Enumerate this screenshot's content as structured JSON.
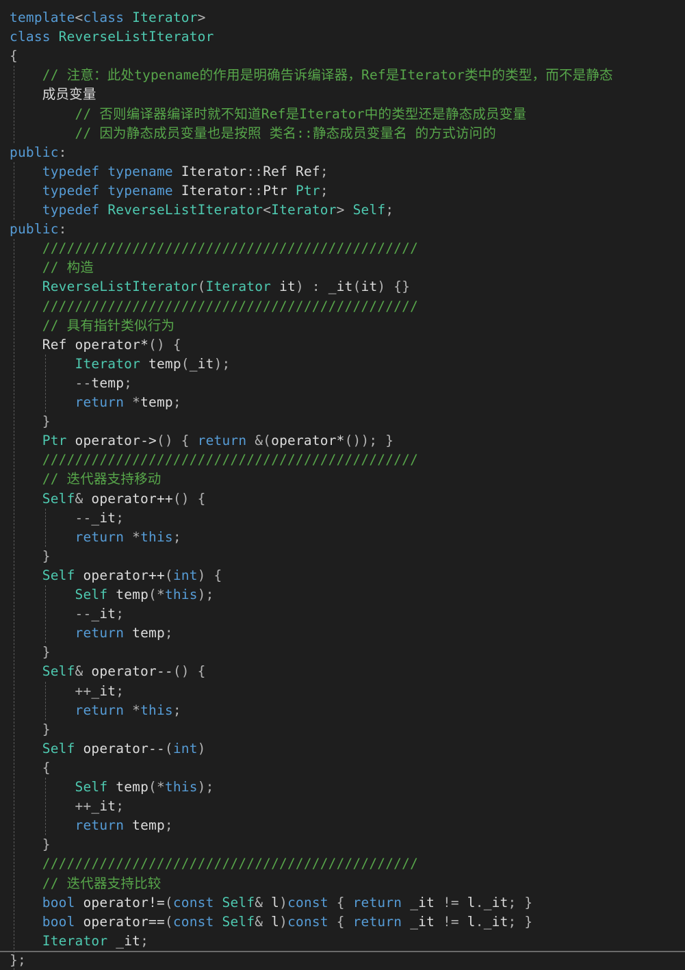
{
  "theme": {
    "background": "#1e1e1e",
    "plain": "#dcdcdc",
    "keyword": "#569cd6",
    "type": "#4ec9b0",
    "comment": "#57a64a",
    "punct": "#b4b4b4",
    "identifier": "#9cdcfe",
    "number": "#b5cea8"
  },
  "code": {
    "lines": [
      [
        [
          "kw",
          "template"
        ],
        [
          "p",
          "<"
        ],
        [
          "kw",
          "class"
        ],
        [
          "p",
          " "
        ],
        [
          "ty",
          "Iterator"
        ],
        [
          "p",
          ">"
        ]
      ],
      [
        [
          "kw",
          "class"
        ],
        [
          "p",
          " "
        ],
        [
          "ty",
          "ReverseListIterator"
        ]
      ],
      [
        [
          "p",
          "{"
        ]
      ],
      [
        [
          "p",
          "    "
        ],
        [
          "cm",
          "// 注意：此处typename的作用是明确告诉编译器，Ref是Iterator类中的类型，而不是静态"
        ]
      ],
      [
        [
          "p",
          "    "
        ],
        [
          "pl",
          "成员变量"
        ]
      ],
      [
        [
          "p",
          "        "
        ],
        [
          "cm",
          "// 否则编译器编译时就不知道Ref是Iterator中的类型还是静态成员变量"
        ]
      ],
      [
        [
          "p",
          "        "
        ],
        [
          "cm",
          "// 因为静态成员变量也是按照 类名::静态成员变量名 的方式访问的"
        ]
      ],
      [
        [
          "kw",
          "public"
        ],
        [
          "p",
          ":"
        ]
      ],
      [
        [
          "p",
          "    "
        ],
        [
          "kw",
          "typedef"
        ],
        [
          "p",
          " "
        ],
        [
          "kw",
          "typename"
        ],
        [
          "p",
          " "
        ],
        [
          "pl",
          "Iterator"
        ],
        [
          "p",
          "::"
        ],
        [
          "pl",
          "Ref"
        ],
        [
          "p",
          " "
        ],
        [
          "pl",
          "Ref"
        ],
        [
          "p",
          ";"
        ]
      ],
      [
        [
          "p",
          "    "
        ],
        [
          "kw",
          "typedef"
        ],
        [
          "p",
          " "
        ],
        [
          "kw",
          "typename"
        ],
        [
          "p",
          " "
        ],
        [
          "pl",
          "Iterator"
        ],
        [
          "p",
          "::"
        ],
        [
          "pl",
          "Ptr"
        ],
        [
          "p",
          " "
        ],
        [
          "ty",
          "Ptr"
        ],
        [
          "p",
          ";"
        ]
      ],
      [
        [
          "p",
          "    "
        ],
        [
          "kw",
          "typedef"
        ],
        [
          "p",
          " "
        ],
        [
          "ty",
          "ReverseListIterator"
        ],
        [
          "p",
          "<"
        ],
        [
          "ty",
          "Iterator"
        ],
        [
          "p",
          "> "
        ],
        [
          "ty",
          "Self"
        ],
        [
          "p",
          ";"
        ]
      ],
      [
        [
          "kw",
          "public"
        ],
        [
          "p",
          ":"
        ]
      ],
      [
        [
          "p",
          "    "
        ],
        [
          "cm",
          "//////////////////////////////////////////////"
        ]
      ],
      [
        [
          "p",
          "    "
        ],
        [
          "cm",
          "// 构造"
        ]
      ],
      [
        [
          "p",
          "    "
        ],
        [
          "fn",
          "ReverseListIterator"
        ],
        [
          "p",
          "("
        ],
        [
          "ty",
          "Iterator"
        ],
        [
          "p",
          " "
        ],
        [
          "pl",
          "it"
        ],
        [
          "p",
          ") : "
        ],
        [
          "pl",
          "_it"
        ],
        [
          "p",
          "("
        ],
        [
          "pl",
          "it"
        ],
        [
          "p",
          ") {}"
        ]
      ],
      [
        [
          "p",
          "    "
        ],
        [
          "cm",
          "//////////////////////////////////////////////"
        ]
      ],
      [
        [
          "p",
          "    "
        ],
        [
          "cm",
          "// 具有指针类似行为"
        ]
      ],
      [
        [
          "p",
          "    "
        ],
        [
          "pl",
          "Ref"
        ],
        [
          "p",
          " "
        ],
        [
          "pl",
          "operator*"
        ],
        [
          "p",
          "() {"
        ]
      ],
      [
        [
          "p",
          "        "
        ],
        [
          "ty",
          "Iterator"
        ],
        [
          "p",
          " "
        ],
        [
          "pl",
          "temp"
        ],
        [
          "p",
          "("
        ],
        [
          "pl",
          "_it"
        ],
        [
          "p",
          ");"
        ]
      ],
      [
        [
          "p",
          "        --"
        ],
        [
          "pl",
          "temp"
        ],
        [
          "p",
          ";"
        ]
      ],
      [
        [
          "p",
          "        "
        ],
        [
          "kw",
          "return"
        ],
        [
          "p",
          " *"
        ],
        [
          "pl",
          "temp"
        ],
        [
          "p",
          ";"
        ]
      ],
      [
        [
          "p",
          "    }"
        ]
      ],
      [
        [
          "p",
          "    "
        ],
        [
          "ty",
          "Ptr"
        ],
        [
          "p",
          " "
        ],
        [
          "pl",
          "operator->"
        ],
        [
          "p",
          "() { "
        ],
        [
          "kw",
          "return"
        ],
        [
          "p",
          " &("
        ],
        [
          "pl",
          "operator*"
        ],
        [
          "p",
          "()); }"
        ]
      ],
      [
        [
          "p",
          "    "
        ],
        [
          "cm",
          "//////////////////////////////////////////////"
        ]
      ],
      [
        [
          "p",
          "    "
        ],
        [
          "cm",
          "// 迭代器支持移动"
        ]
      ],
      [
        [
          "p",
          "    "
        ],
        [
          "ty",
          "Self"
        ],
        [
          "p",
          "& "
        ],
        [
          "pl",
          "operator++"
        ],
        [
          "p",
          "() {"
        ]
      ],
      [
        [
          "p",
          "        --"
        ],
        [
          "pl",
          "_it"
        ],
        [
          "p",
          ";"
        ]
      ],
      [
        [
          "p",
          "        "
        ],
        [
          "kw",
          "return"
        ],
        [
          "p",
          " *"
        ],
        [
          "kw",
          "this"
        ],
        [
          "p",
          ";"
        ]
      ],
      [
        [
          "p",
          "    }"
        ]
      ],
      [
        [
          "p",
          "    "
        ],
        [
          "ty",
          "Self"
        ],
        [
          "p",
          " "
        ],
        [
          "pl",
          "operator++"
        ],
        [
          "p",
          "("
        ],
        [
          "kw",
          "int"
        ],
        [
          "p",
          ") {"
        ]
      ],
      [
        [
          "p",
          "        "
        ],
        [
          "ty",
          "Self"
        ],
        [
          "p",
          " "
        ],
        [
          "pl",
          "temp"
        ],
        [
          "p",
          "(*"
        ],
        [
          "kw",
          "this"
        ],
        [
          "p",
          ");"
        ]
      ],
      [
        [
          "p",
          "        --"
        ],
        [
          "pl",
          "_it"
        ],
        [
          "p",
          ";"
        ]
      ],
      [
        [
          "p",
          "        "
        ],
        [
          "kw",
          "return"
        ],
        [
          "p",
          " "
        ],
        [
          "pl",
          "temp"
        ],
        [
          "p",
          ";"
        ]
      ],
      [
        [
          "p",
          "    }"
        ]
      ],
      [
        [
          "p",
          "    "
        ],
        [
          "ty",
          "Self"
        ],
        [
          "p",
          "& "
        ],
        [
          "pl",
          "operator--"
        ],
        [
          "p",
          "() {"
        ]
      ],
      [
        [
          "p",
          "        ++"
        ],
        [
          "pl",
          "_it"
        ],
        [
          "p",
          ";"
        ]
      ],
      [
        [
          "p",
          "        "
        ],
        [
          "kw",
          "return"
        ],
        [
          "p",
          " *"
        ],
        [
          "kw",
          "this"
        ],
        [
          "p",
          ";"
        ]
      ],
      [
        [
          "p",
          "    }"
        ]
      ],
      [
        [
          "p",
          "    "
        ],
        [
          "ty",
          "Self"
        ],
        [
          "p",
          " "
        ],
        [
          "pl",
          "operator--"
        ],
        [
          "p",
          "("
        ],
        [
          "kw",
          "int"
        ],
        [
          "p",
          ")"
        ]
      ],
      [
        [
          "p",
          "    {"
        ]
      ],
      [
        [
          "p",
          "        "
        ],
        [
          "ty",
          "Self"
        ],
        [
          "p",
          " "
        ],
        [
          "pl",
          "temp"
        ],
        [
          "p",
          "(*"
        ],
        [
          "kw",
          "this"
        ],
        [
          "p",
          ");"
        ]
      ],
      [
        [
          "p",
          "        ++"
        ],
        [
          "pl",
          "_it"
        ],
        [
          "p",
          ";"
        ]
      ],
      [
        [
          "p",
          "        "
        ],
        [
          "kw",
          "return"
        ],
        [
          "p",
          " "
        ],
        [
          "pl",
          "temp"
        ],
        [
          "p",
          ";"
        ]
      ],
      [
        [
          "p",
          "    }"
        ]
      ],
      [
        [
          "p",
          "    "
        ],
        [
          "cm",
          "//////////////////////////////////////////////"
        ]
      ],
      [
        [
          "p",
          "    "
        ],
        [
          "cm",
          "// 迭代器支持比较"
        ]
      ],
      [
        [
          "p",
          "    "
        ],
        [
          "kw",
          "bool"
        ],
        [
          "p",
          " "
        ],
        [
          "pl",
          "operator!="
        ],
        [
          "p",
          "("
        ],
        [
          "kw",
          "const"
        ],
        [
          "p",
          " "
        ],
        [
          "ty",
          "Self"
        ],
        [
          "p",
          "& "
        ],
        [
          "pl",
          "l"
        ],
        [
          "p",
          ")"
        ],
        [
          "kw",
          "const"
        ],
        [
          "p",
          " { "
        ],
        [
          "kw",
          "return"
        ],
        [
          "p",
          " "
        ],
        [
          "pl",
          "_it"
        ],
        [
          "p",
          " != "
        ],
        [
          "pl",
          "l"
        ],
        [
          "p",
          "."
        ],
        [
          "pl",
          "_it"
        ],
        [
          "p",
          "; }"
        ]
      ],
      [
        [
          "p",
          "    "
        ],
        [
          "kw",
          "bool"
        ],
        [
          "p",
          " "
        ],
        [
          "pl",
          "operator=="
        ],
        [
          "p",
          "("
        ],
        [
          "kw",
          "const"
        ],
        [
          "p",
          " "
        ],
        [
          "ty",
          "Self"
        ],
        [
          "p",
          "& "
        ],
        [
          "pl",
          "l"
        ],
        [
          "p",
          ")"
        ],
        [
          "kw",
          "const"
        ],
        [
          "p",
          " { "
        ],
        [
          "kw",
          "return"
        ],
        [
          "p",
          " "
        ],
        [
          "pl",
          "_it"
        ],
        [
          "p",
          " != "
        ],
        [
          "pl",
          "l"
        ],
        [
          "p",
          "."
        ],
        [
          "pl",
          "_it"
        ],
        [
          "p",
          "; }"
        ]
      ],
      [
        [
          "p",
          "    "
        ],
        [
          "ty",
          "Iterator"
        ],
        [
          "p",
          " "
        ],
        [
          "pl",
          "_it"
        ],
        [
          "p",
          ";"
        ]
      ],
      [
        [
          "p",
          "};"
        ]
      ]
    ]
  }
}
